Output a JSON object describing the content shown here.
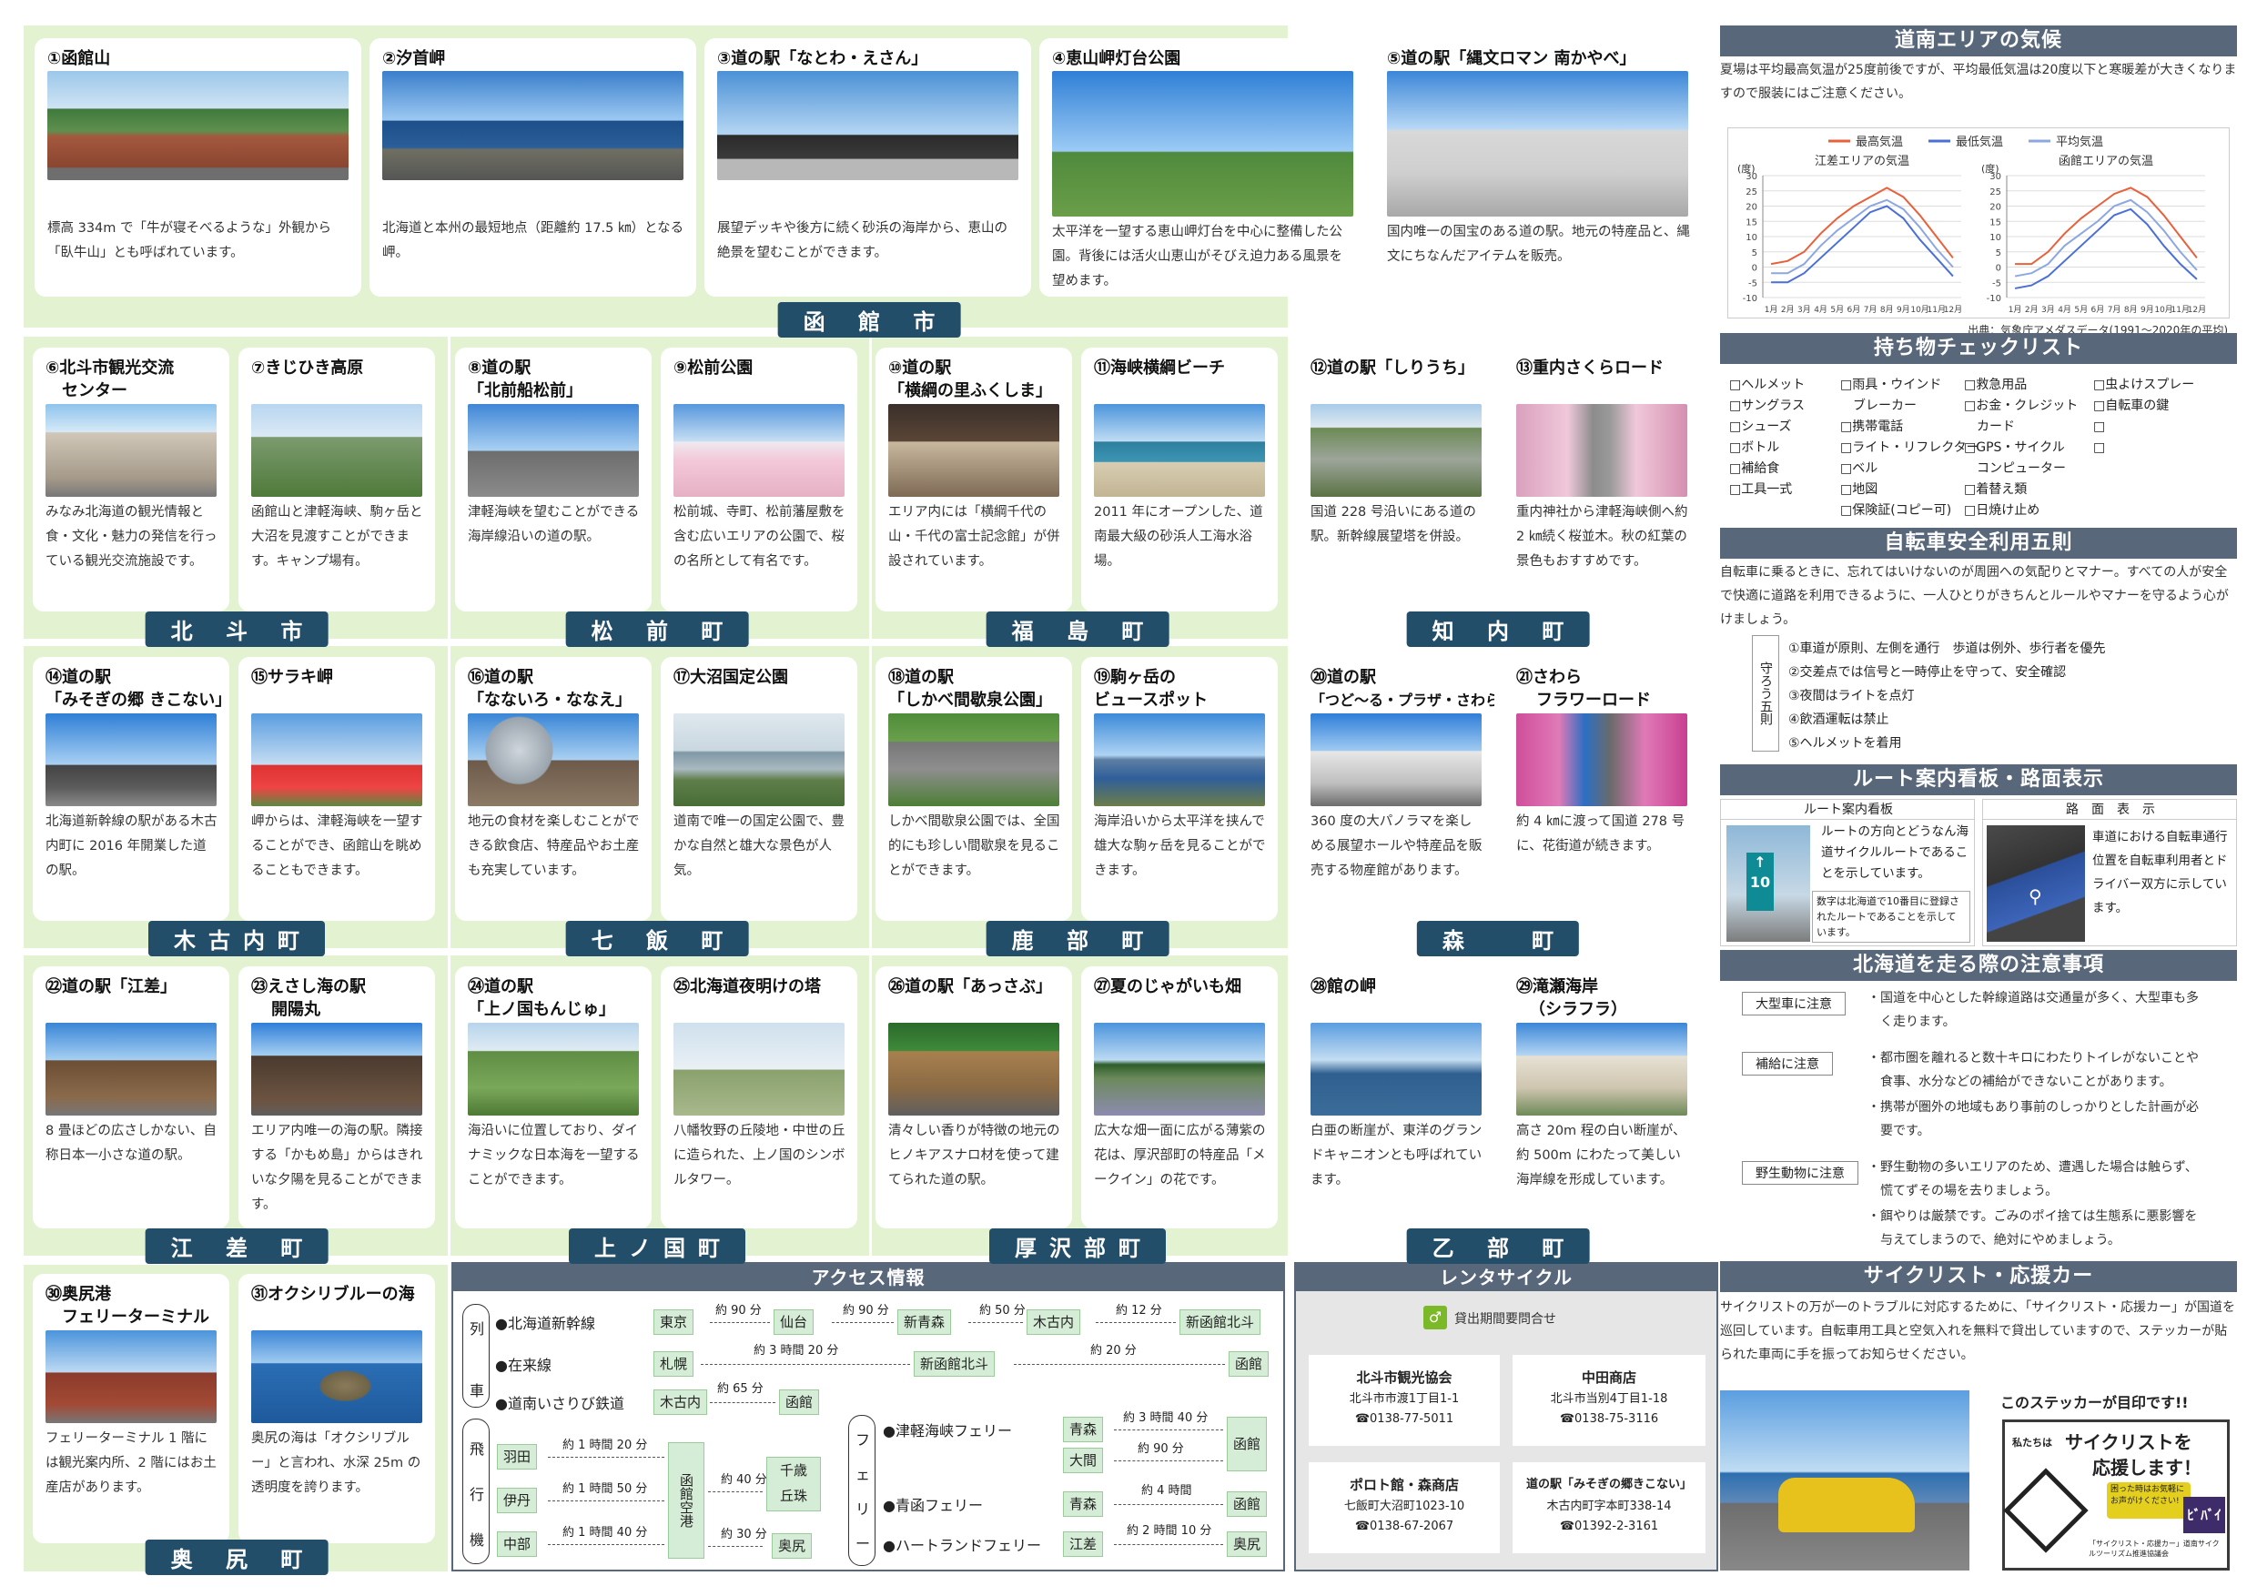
{
  "hakodate_spots": [
    {
      "title": "①函館山",
      "desc": "標高 334m で「牛が寝そべるような」外観から「臥牛山」とも呼ばれています。"
    },
    {
      "title": "②汐首岬",
      "desc": "北海道と本州の最短地点（距離約 17.5 ㎞）となる岬。"
    },
    {
      "title": "③道の駅「なとわ・えさん」",
      "desc": "展望デッキや後方に続く砂浜の海岸から、恵山の絶景を望むことができます。"
    },
    {
      "title": "④恵山岬灯台公園",
      "desc": "太平洋を一望する恵山岬灯台を中心に整備した公園。背後には活火山恵山がそびえ迫力ある風景を望めます。"
    },
    {
      "title": "⑤道の駅「縄文ロマン 南かやべ」",
      "desc": "国内唯一の国宝のある道の駅。地元の特産品と、縄文にちなんだアイテムを販売。"
    }
  ],
  "towns": [
    "函 館 市",
    "北 斗 市",
    "松 前 町",
    "福 島 町",
    "知 内 町",
    "木古内町",
    "七 飯 町",
    "鹿 部 町",
    "森　 町",
    "江 差 町",
    "上ノ国町",
    "厚沢部町",
    "乙 部 町",
    "奥 尻 町"
  ],
  "spots": [
    {
      "title": "⑥北斗市観光交流",
      "title2": "センター",
      "desc": "みなみ北海道の観光情報と食・文化・魅力の発信を行っている観光交流施設です。"
    },
    {
      "title": "⑦きじひき高原",
      "title2": "",
      "desc": "函館山と津軽海峡、駒ヶ岳と大沼を見渡すことができます。キャンプ場有。"
    },
    {
      "title": "⑧道の駅",
      "title2": "「北前船松前」",
      "desc": "津軽海峡を望むことができる海岸線沿いの道の駅。"
    },
    {
      "title": "⑨松前公園",
      "title2": "",
      "desc": "松前城、寺町、松前藩屋敷を含む広いエリアの公園で、桜の名所として有名です。"
    },
    {
      "title": "⑩道の駅",
      "title2": "「横綱の里ふくしま」",
      "desc": "エリア内には「横綱千代の山・千代の富士記念館」が併設されています。"
    },
    {
      "title": "⑪海峡横綱ビーチ",
      "title2": "",
      "desc": "2011 年にオープンした、道南最大級の砂浜人工海水浴場。"
    },
    {
      "title": "⑫道の駅「しりうち」",
      "title2": "",
      "desc": "国道 228 号沿いにある道の駅。新幹線展望塔を併設。"
    },
    {
      "title": "⑬重内さくらロード",
      "title2": "",
      "desc": "重内神社から津軽海峡側へ約 2 ㎞続く桜並木。秋の紅葉の景色もおすすめです。"
    },
    {
      "title": "⑭道の駅",
      "title2": "「みそぎの郷 きこない」",
      "desc": "北海道新幹線の駅がある木古内町に 2016 年開業した道の駅。"
    },
    {
      "title": "⑮サラキ岬",
      "title2": "",
      "desc": "岬からは、津軽海峡を一望することができ、函館山を眺めることもできます。"
    },
    {
      "title": "⑯道の駅",
      "title2": "「なないろ・ななえ」",
      "desc": "地元の食材を楽しむことができる飲食店、特産品やお土産も充実しています。"
    },
    {
      "title": "⑰大沼国定公園",
      "title2": "",
      "desc": "道南で唯一の国定公園で、豊かな自然と雄大な景色が人気。"
    },
    {
      "title": "⑱道の駅",
      "title2": "「しかべ間歇泉公園」",
      "desc": "しかべ間歇泉公園では、全国的にも珍しい間歇泉を見ることができます。"
    },
    {
      "title": "⑲駒ヶ岳の",
      "title2": "ビュースポット",
      "desc": "海岸沿いから太平洋を挟んで雄大な駒ヶ岳を見ることができます。"
    },
    {
      "title": "⑳道の駅",
      "title2": "「つど～る・プラザ・さわら」",
      "desc": "360 度の大パノラマを楽しめる展望ホールや特産品を販売する物産館があります。"
    },
    {
      "title": "㉑さわら",
      "title2": "フラワーロード",
      "desc": "約 4 ㎞に渡って国道 278 号に、花街道が続きます。"
    },
    {
      "title": "㉒道の駅「江差」",
      "title2": "",
      "desc": "8 畳ほどの広さしかない、自称日本一小さな道の駅。"
    },
    {
      "title": "㉓えさし海の駅",
      "title2": "開陽丸",
      "desc": "エリア内唯一の海の駅。隣接する「かもめ島」からはきれいな夕陽を見ることができます。"
    },
    {
      "title": "㉔道の駅",
      "title2": "「上ノ国もんじゅ」",
      "desc": "海沿いに位置しており、ダイナミックな日本海を一望することができます。"
    },
    {
      "title": "㉕北海道夜明けの塔",
      "title2": "",
      "desc": "八幡牧野の丘陵地・中世の丘に造られた、上ノ国のシンボルタワー。"
    },
    {
      "title": "㉖道の駅「あっさぶ」",
      "title2": "",
      "desc": "清々しい香りが特徴の地元のヒノキアスナロ材を使って建てられた道の駅。"
    },
    {
      "title": "㉗夏のじゃがいも畑",
      "title2": "",
      "desc": "広大な畑一面に広がる薄紫の花は、厚沢部町の特産品「メークイン」の花です。"
    },
    {
      "title": "㉘館の岬",
      "title2": "",
      "desc": "白亜の断崖が、東洋のグランドキャニオンとも呼ばれています。"
    },
    {
      "title": "㉙滝瀬海岸",
      "title2": "（シラフラ）",
      "desc": "高さ 20m 程の白い断崖が、約 500m にわたって美しい海岸線を形成しています。"
    },
    {
      "title": "㉚奥尻港",
      "title2": "フェリーターミナル",
      "desc": "フェリーターミナル 1 階には観光案内所、2 階にはお土産店があります。"
    },
    {
      "title": "㉛オクシリブルーの海",
      "title2": "",
      "desc": "奥尻の海は「オクシリブルー」と言われ、水深 25m の透明度を誇ります。"
    }
  ],
  "climate": {
    "heading": "道南エリアの気候",
    "text": "夏場は平均最高気温が25度前後ですが、平均最低気温は20度以下と寒暖差が大きくなりますので服装にはご注意ください。",
    "legend": [
      "最高気温",
      "最低気温",
      "平均気温"
    ],
    "source": "出典：気象庁アメダスデータ(1991～2020年の平均)"
  },
  "chart_data": [
    {
      "type": "line",
      "title": "江差エリアの気温",
      "ylabel": "(度)",
      "categories": [
        "1月",
        "2月",
        "3月",
        "4月",
        "5月",
        "6月",
        "7月",
        "8月",
        "9月",
        "10月",
        "11月",
        "12月"
      ],
      "ylim": [
        -10,
        30
      ],
      "series": [
        {
          "name": "最高気温",
          "color": "#e8603c",
          "values": [
            1,
            2,
            5,
            11,
            16,
            20,
            23,
            26,
            23,
            17,
            10,
            3
          ]
        },
        {
          "name": "最低気温",
          "color": "#4a6fd6",
          "values": [
            -5,
            -5,
            -2,
            3,
            8,
            13,
            18,
            20,
            16,
            9,
            3,
            -3
          ]
        },
        {
          "name": "平均気温",
          "color": "#8da7e0",
          "values": [
            -2,
            -2,
            1,
            7,
            12,
            16,
            20,
            22,
            19,
            13,
            6,
            0
          ]
        }
      ]
    },
    {
      "type": "line",
      "title": "函館エリアの気温",
      "ylabel": "(度)",
      "categories": [
        "1月",
        "2月",
        "3月",
        "4月",
        "5月",
        "6月",
        "7月",
        "8月",
        "9月",
        "10月",
        "11月",
        "12月"
      ],
      "ylim": [
        -10,
        30
      ],
      "series": [
        {
          "name": "最高気温",
          "color": "#e8603c",
          "values": [
            1,
            1,
            5,
            11,
            16,
            20,
            24,
            26,
            23,
            17,
            10,
            3
          ]
        },
        {
          "name": "最低気温",
          "color": "#4a6fd6",
          "values": [
            -7,
            -6,
            -3,
            2,
            7,
            12,
            17,
            19,
            14,
            7,
            1,
            -4
          ]
        },
        {
          "name": "平均気温",
          "color": "#8da7e0",
          "values": [
            -3,
            -2,
            1,
            7,
            11,
            15,
            20,
            22,
            18,
            12,
            5,
            -1
          ]
        }
      ]
    }
  ],
  "checklist": {
    "heading": "持ち物チェックリスト",
    "items": [
      "□ヘルメット",
      "□サングラス",
      "□シューズ",
      "□ボトル",
      "□補給食",
      "□工具一式",
      "□雨具・ウインド",
      "　ブレーカー",
      "□携帯電話",
      "□ライト・リフレクター",
      "□ベル",
      "□地図",
      "□保険証(コピー可)",
      "□救急用品",
      "□お金・クレジット",
      "　カード",
      "□GPS・サイクル",
      "　コンピューター",
      "□着替え類",
      "□日焼け止め",
      "□虫よけスプレー",
      "□自転車の鍵",
      "□",
      "□"
    ]
  },
  "rules": {
    "heading": "自転車安全利用五則",
    "text": "自転車に乗るときに、忘れてはいけないのが周囲への気配りとマナー。すべての人が安全で快適に道路を利用できるように、一人ひとりがきちんとルールやマナーを守るよう心がけましょう。",
    "label": "守ろう五則",
    "items": [
      "①車道が原則、左側を通行　歩道は例外、歩行者を優先",
      "②交差点では信号と一時停止を守って、安全確認",
      "③夜間はライトを点灯",
      "④飲酒運転は禁止",
      "⑤ヘルメットを着用"
    ]
  },
  "route": {
    "heading": "ルート案内看板・路面表示",
    "sign_label": "ルート案内看板",
    "sign_text": "ルートの方向とどうなん海道サイクルルートであることを示しています。",
    "sign_note": "数字は北海道で10番目に登録されたルートであることを示しています。",
    "sign_number": "10",
    "road_label": "路　面　表　示",
    "road_text": "車道における自転車通行位置を自転車利用者とドライバー双方に示しています。"
  },
  "cautions": {
    "heading": "北海道を走る際の注意事項",
    "items": [
      {
        "tag": "大型車に注意",
        "lines": [
          "・国道を中心とした幹線道路は交通量が多く、大型車も多",
          "　く走ります。"
        ]
      },
      {
        "tag": "補給に注意",
        "lines": [
          "・都市圏を離れると数十キロにわたりトイレがないことや",
          "　食事、水分などの補給ができないことがあります。",
          "・携帯が圏外の地域もあり事前のしっかりとした計画が必",
          "　要です。"
        ]
      },
      {
        "tag": "野生動物に注意",
        "lines": [
          "・野生動物の多いエリアのため、遭遇した場合は触らず、",
          "　慌てずその場を去りましょう。",
          "・餌やりは厳禁です。ごみのポイ捨ては生態系に悪影響を",
          "　与えてしまうので、絶対にやめましょう。"
        ]
      }
    ]
  },
  "support": {
    "heading": "サイクリスト・応援カー",
    "text": "サイクリストの万が一のトラブルに対応するために、「サイクリスト・応援カー」が国道を巡回しています。自転車用工具と空気入れを無料で貸出していますので、ステッカーが貼られた車両に手を振ってお知らせください。",
    "sticker_caption": "このステッカーが目印です!!",
    "sticker_top": "私たちは",
    "sticker_main1": "サイクリストを",
    "sticker_main2": "応援します！",
    "sticker_badge": "困った時はお気軽にお声がけください!",
    "sticker_logo": "ﾋﾞﾊﾞｲ",
    "sticker_foot": "「サイクリスト・応援カー」道南サイクルツーリズム推進協議会"
  },
  "access": {
    "heading": "アクセス情報",
    "cat_train": [
      "列",
      "車"
    ],
    "cat_plane": [
      "飛",
      "行",
      "機"
    ],
    "cat_ferry": [
      "フ",
      "ェ",
      "リ",
      "ー"
    ],
    "rows": {
      "shinkansen": {
        "label": "●北海道新幹線",
        "stations": [
          "東京",
          "仙台",
          "新青森",
          "木古内",
          "新函館北斗"
        ],
        "durations": [
          "約 90 分",
          "約 90 分",
          "約 50 分",
          "約 12 分"
        ]
      },
      "zairai": {
        "label": "●在来線",
        "stations": [
          "札幌",
          "新函館北斗",
          "函館"
        ],
        "durations": [
          "約 3 時間 20 分",
          "約 20 分"
        ]
      },
      "isaribi": {
        "label": "●道南いさりび鉄道",
        "stations": [
          "木古内",
          "函館"
        ],
        "durations": [
          "約 65 分"
        ]
      },
      "haneda": {
        "from": "羽田",
        "dur": "約 1 時間 20 分"
      },
      "itami": {
        "from": "伊丹",
        "dur": "約 1 時間 50 分"
      },
      "chubu": {
        "from": "中部",
        "dur": "約 1 時間 40 分"
      },
      "airport": "函館空港",
      "chitose": {
        "to": "千歳\n丘珠",
        "to1": "千歳",
        "to2": "丘珠",
        "dur": "約 40 分"
      },
      "okushiri_air": {
        "to": "奥尻",
        "dur": "約 30 分"
      },
      "tsugaru": {
        "label": "●津軽海峡フェリー",
        "from1": "青森",
        "from2": "大間",
        "dur1": "約 3 時間 40 分",
        "dur2": "約 90 分",
        "to": "函館"
      },
      "seikan": {
        "label": "●青函フェリー",
        "from": "青森",
        "dur": "約 4 時間",
        "to": "函館"
      },
      "heartland": {
        "label": "●ハートランドフェリー",
        "from": "江差",
        "dur": "約 2 時間 10 分",
        "to": "奥尻"
      }
    }
  },
  "rental": {
    "heading": "レンタサイクル",
    "notice": "貸出期間要問合せ",
    "shops": [
      {
        "name": "北斗市観光協会",
        "addr": "北斗市市渡1丁目1-1",
        "tel": "☎0138-77-5011"
      },
      {
        "name": "中田商店",
        "addr": "北斗市当別4丁目1-18",
        "tel": "☎0138-75-3116"
      },
      {
        "name": "ポロト館・森商店",
        "addr": "七飯町大沼町1023-10",
        "tel": "☎0138-67-2067"
      },
      {
        "name": "道の駅「みそぎの郷きこない」",
        "addr": "木古内町字本町338-14",
        "tel": "☎01392-2-3161"
      }
    ]
  }
}
